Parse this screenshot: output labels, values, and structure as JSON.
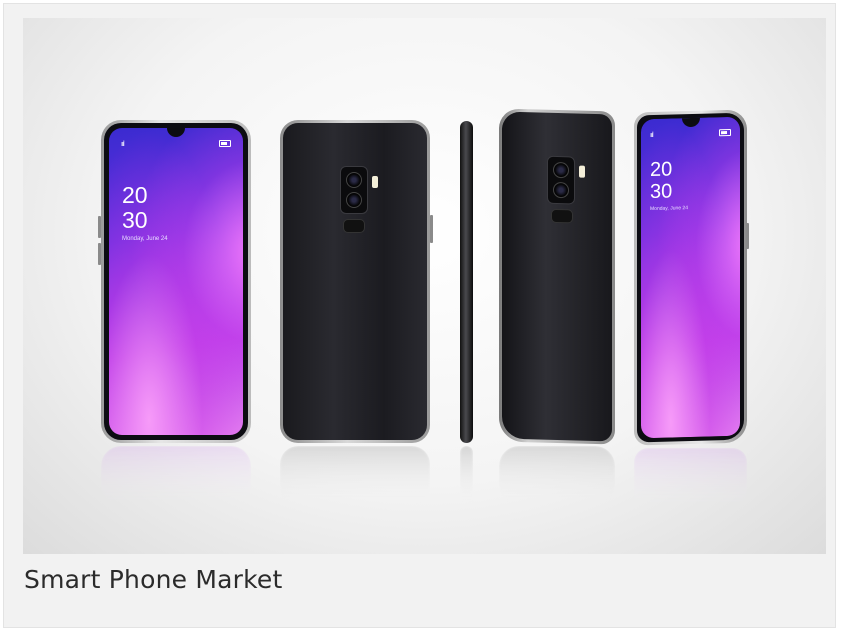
{
  "caption": "Smart Phone Market",
  "phone_screen": {
    "hour": "20",
    "minute": "30",
    "date": "Monday, June 24",
    "signal": "ııl"
  },
  "colors": {
    "screen_gradient_start": "#3a2bd0",
    "screen_gradient_end": "#e27af0",
    "phone_body": "#1e1e22",
    "frame": "#c8c8c8",
    "card_bg": "#f2f2f2"
  },
  "icons": [
    "signal-icon",
    "battery-icon",
    "camera-lens-icon",
    "flash-icon",
    "fingerprint-sensor-icon"
  ]
}
